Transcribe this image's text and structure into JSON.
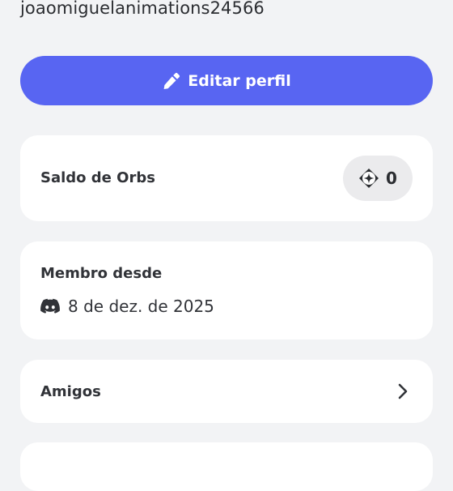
{
  "profile": {
    "username": "joaomiguelanimations24566"
  },
  "actions": {
    "edit_profile_label": "Editar perfil"
  },
  "orbs": {
    "title": "Saldo de Orbs",
    "balance": "0"
  },
  "member": {
    "title": "Membro desde",
    "date": "8 de dez. de 2025"
  },
  "friends": {
    "title": "Amigos"
  },
  "icons": {
    "edit": "pencil-icon",
    "orbs": "orb-icon",
    "member": "discord-icon",
    "friends": "chevron-right-icon"
  },
  "colors": {
    "accent": "#5865f2",
    "background": "#f2f3f5",
    "card": "#ffffff",
    "pill": "#ebebed"
  }
}
